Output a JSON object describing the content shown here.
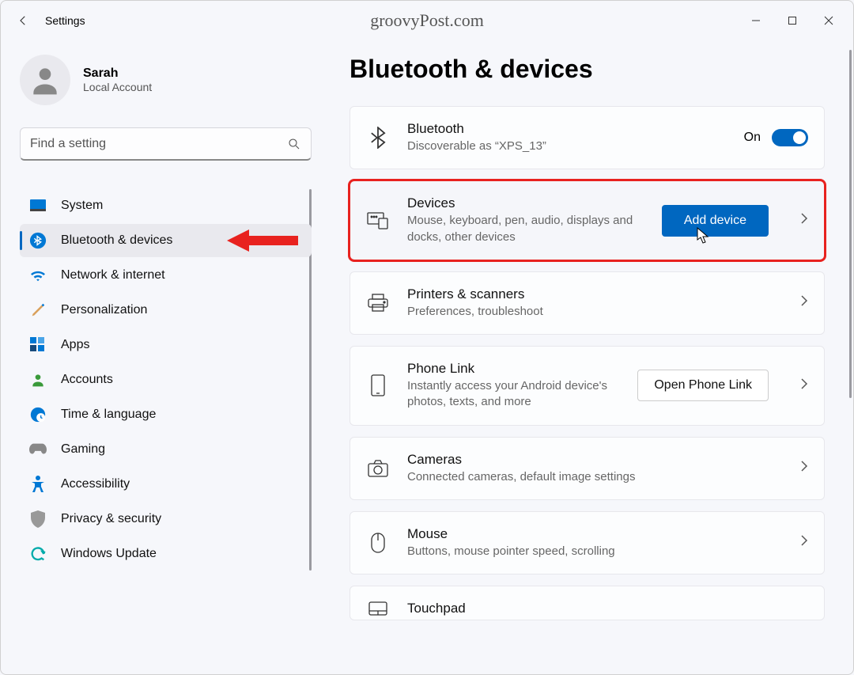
{
  "window": {
    "title": "Settings",
    "watermark": "groovyPost.com"
  },
  "profile": {
    "name": "Sarah",
    "sub": "Local Account"
  },
  "search": {
    "placeholder": "Find a setting"
  },
  "nav": {
    "items": [
      {
        "label": "System"
      },
      {
        "label": "Bluetooth & devices"
      },
      {
        "label": "Network & internet"
      },
      {
        "label": "Personalization"
      },
      {
        "label": "Apps"
      },
      {
        "label": "Accounts"
      },
      {
        "label": "Time & language"
      },
      {
        "label": "Gaming"
      },
      {
        "label": "Accessibility"
      },
      {
        "label": "Privacy & security"
      },
      {
        "label": "Windows Update"
      }
    ]
  },
  "page": {
    "title": "Bluetooth & devices",
    "bluetooth": {
      "title": "Bluetooth",
      "sub": "Discoverable as “XPS_13”",
      "state": "On"
    },
    "devices": {
      "title": "Devices",
      "sub": "Mouse, keyboard, pen, audio, displays and docks, other devices",
      "button": "Add device"
    },
    "printers": {
      "title": "Printers & scanners",
      "sub": "Preferences, troubleshoot"
    },
    "phone": {
      "title": "Phone Link",
      "sub": "Instantly access your Android device's photos, texts, and more",
      "button": "Open Phone Link"
    },
    "cameras": {
      "title": "Cameras",
      "sub": "Connected cameras, default image settings"
    },
    "mouse": {
      "title": "Mouse",
      "sub": "Buttons, mouse pointer speed, scrolling"
    },
    "touchpad": {
      "title": "Touchpad"
    }
  },
  "colors": {
    "accent": "#0067c0",
    "highlight": "#e8221f"
  }
}
